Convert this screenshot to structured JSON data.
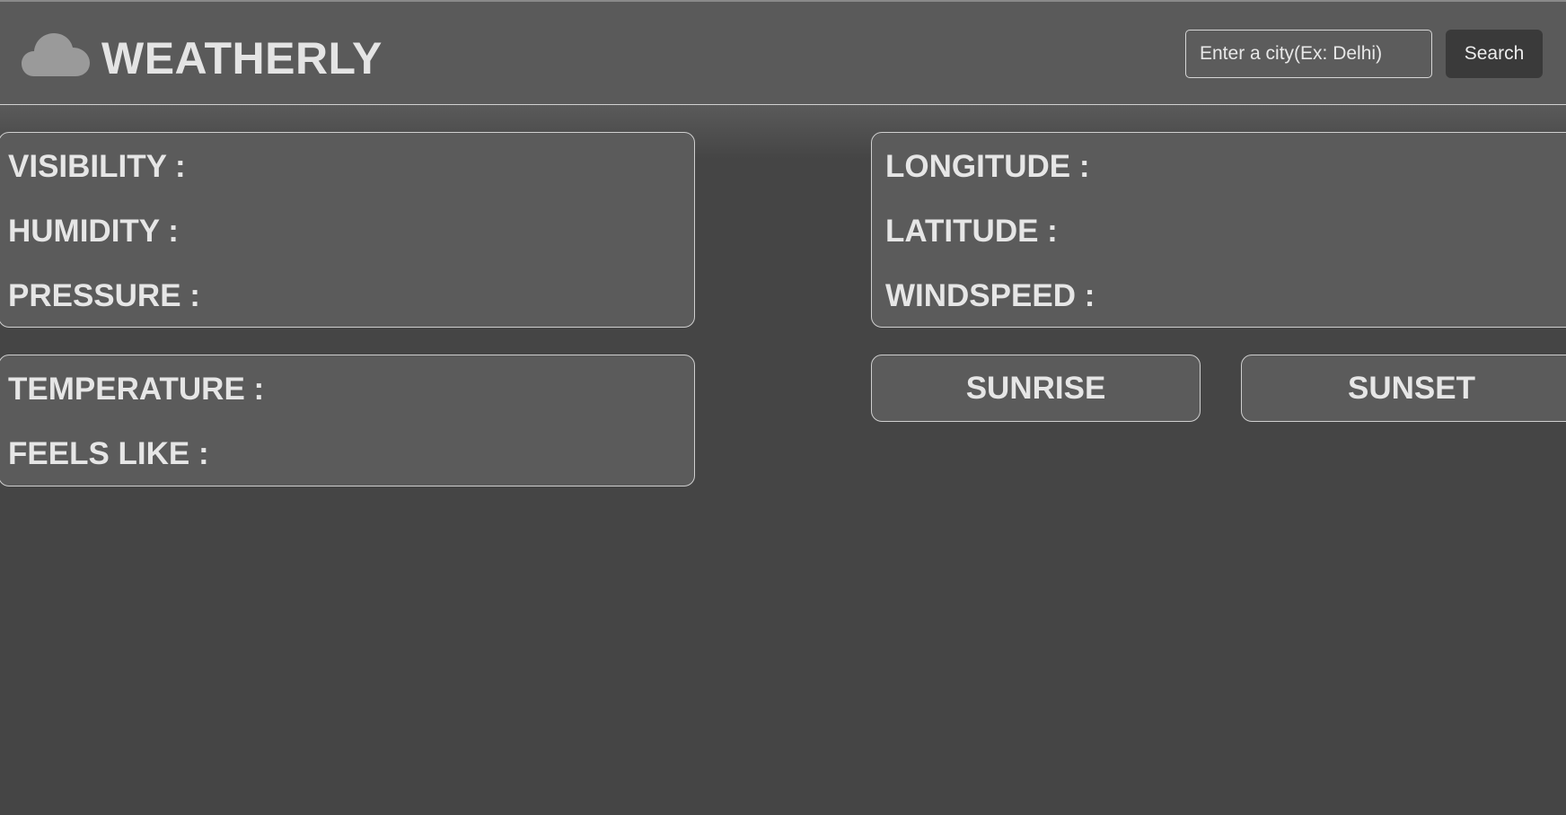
{
  "header": {
    "brand": "WEATHERLY",
    "logo_icon": "cloud-icon",
    "search": {
      "placeholder": "Enter a city(Ex: Delhi)",
      "value": ""
    },
    "search_button_label": "Search"
  },
  "atmosphere_card": {
    "visibility_label": "VISIBILITY :",
    "humidity_label": "HUMIDITY :",
    "pressure_label": "PRESSURE :"
  },
  "location_card": {
    "longitude_label": "LONGITUDE :",
    "latitude_label": "LATITUDE :",
    "windspeed_label": "WINDSPEED :"
  },
  "temperature_card": {
    "temperature_label": "TEMPERATURE :",
    "feels_like_label": "FEELS LIKE :"
  },
  "sun": {
    "sunrise_label": "SUNRISE",
    "sunset_label": "SUNSET"
  },
  "colors": {
    "background": "#454545",
    "header": "#5a5a5a",
    "card": "#5b5b5b",
    "text": "#e6e6e6",
    "search_button": "#3a3a3a"
  }
}
